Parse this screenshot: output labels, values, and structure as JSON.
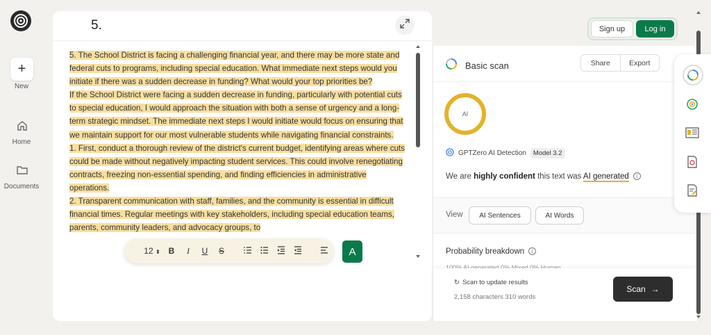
{
  "nav": {
    "new_label": "New",
    "home_label": "Home",
    "documents_label": "Documents"
  },
  "editor": {
    "title": "5.",
    "paragraphs": [
      [
        "5. The School District is facing a challenging financial year, and there may be more state and federal cuts to programs, including special education.",
        " What immediate next steps would you initiate if there was a sudden decrease in funding?",
        " What would your top priorities be?"
      ],
      [
        "If the School District were facing a sudden decrease in funding, particularly with potential cuts to special education, I would approach the situation with both a sense of urgency and a long-term strategic mindset.",
        " The immediate next steps I would initiate would focus on ensuring that we maintain support for our most vulnerable students while navigating financial constraints."
      ],
      [
        "1. First, conduct a thorough review of the district's current budget, identifying areas where cuts could be made without negatively impacting student services.",
        " This could involve renegotiating contracts, freezing non-essential spending, and finding efficiencies in administrative operations."
      ],
      [
        "2. Transparent communication with staff, families, and the community is essential in difficult financial times.",
        " Regular meetings with key stakeholders, including special education teams, parents, community leaders, and advocacy groups, to"
      ]
    ],
    "toolbar": {
      "font_size": "12",
      "bold": "B",
      "italic": "I",
      "underline": "U",
      "strike": "S"
    },
    "grammar_label": "A"
  },
  "auth": {
    "signup_label": "Sign up",
    "login_label": "Log in"
  },
  "panel": {
    "title": "Basic scan",
    "share_label": "Share",
    "export_label": "Export",
    "ring_label": "AI",
    "detector_name": "GPTZero AI Detection",
    "model_badge": "Model 3.2",
    "verdict_prefix": "We are ",
    "verdict_strong": "highly confident",
    "verdict_mid": " this text was ",
    "verdict_label": "AI generated",
    "view_label": "View",
    "ai_sentences_label": "AI Sentences",
    "ai_words_label": "AI Words",
    "probability_title": "Probability breakdown",
    "probability_sub": "100% AI generated     0% Mixed     0% Human",
    "scan_note": "Scan to update results",
    "char_count": "2,158 characters 310 words",
    "scan_button": "Scan"
  },
  "colors": {
    "accent": "#0b7a4b",
    "highlight": "#f7dfa0",
    "ring": "#e4b22b"
  }
}
